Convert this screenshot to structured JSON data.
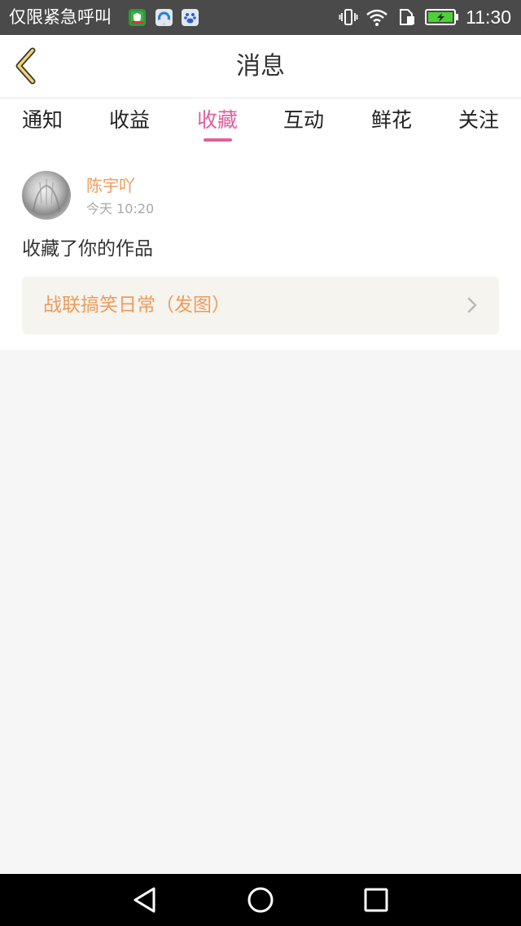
{
  "status_bar": {
    "carrier": "仅限紧急呼叫",
    "time": "11:30"
  },
  "header": {
    "title": "消息"
  },
  "tabs": [
    {
      "label": "通知",
      "active": false
    },
    {
      "label": "收益",
      "active": false
    },
    {
      "label": "收藏",
      "active": true
    },
    {
      "label": "互动",
      "active": false
    },
    {
      "label": "鲜花",
      "active": false
    },
    {
      "label": "关注",
      "active": false
    }
  ],
  "message": {
    "username": "陈宇吖",
    "timestamp": "今天 10:20",
    "action": "收藏了你的作品",
    "work_title": "战联搞笑日常（发图）"
  },
  "colors": {
    "accent": "#e05f9e",
    "highlight": "#ef9b5c",
    "status_bar": "#4a4a4a",
    "card_bg": "#f5f4ee"
  },
  "icons": {
    "back": "chevron-left-icon",
    "work_link": "chevron-right-icon",
    "nav": [
      "back-triangle-icon",
      "home-circle-icon",
      "recents-square-icon"
    ]
  }
}
